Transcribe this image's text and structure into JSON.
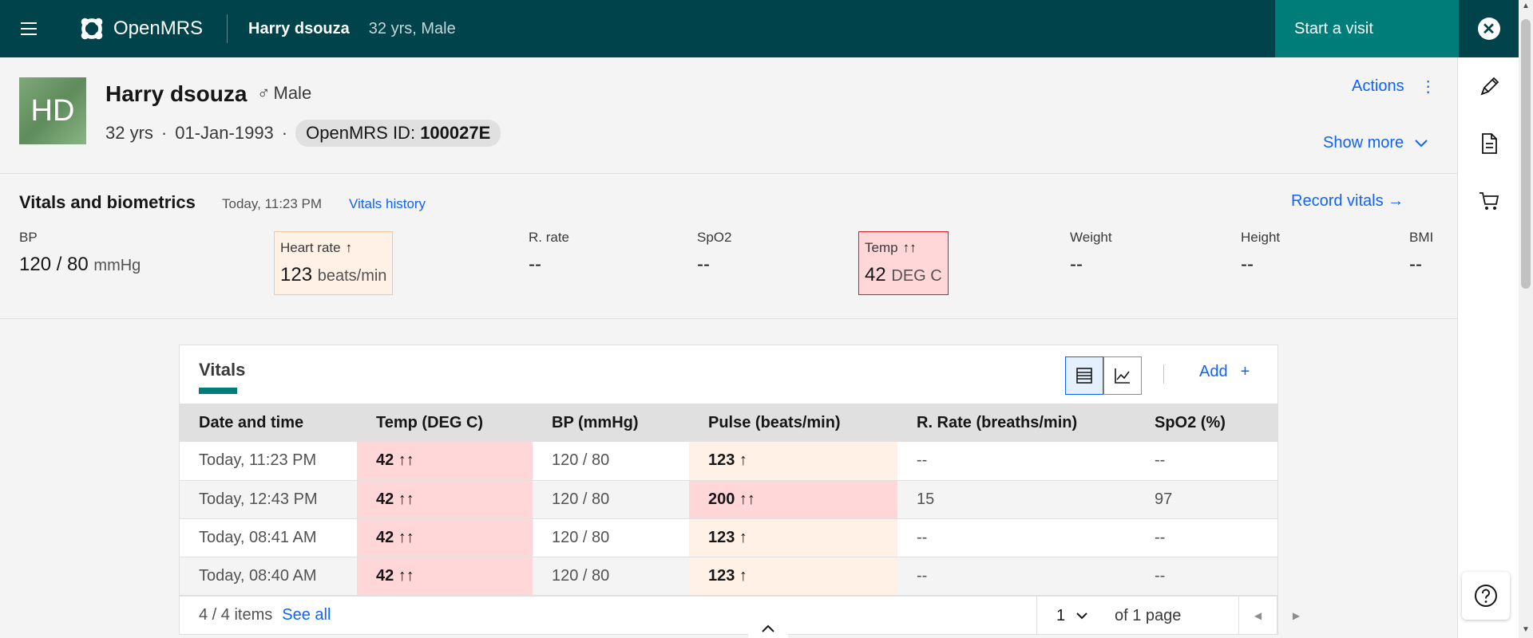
{
  "header": {
    "app_name": "OpenMRS",
    "patient_name": "Harry dsouza",
    "patient_info": "32 yrs, Male",
    "start_visit": "Start a visit"
  },
  "banner": {
    "initials": "HD",
    "name": "Harry dsouza",
    "sex_symbol": "♂",
    "sex": "Male",
    "age": "32 yrs",
    "dot": "·",
    "dob": "01-Jan-1993",
    "id_label": "OpenMRS ID:",
    "id_value": "100027E",
    "actions": "Actions",
    "show_more": "Show more"
  },
  "vitals_header": {
    "title": "Vitals and biometrics",
    "time": "Today, 11:23 PM",
    "history": "Vitals history",
    "record": "Record vitals",
    "items": [
      {
        "label": "BP",
        "value": "120 / 80",
        "unit": "mmHg",
        "flag": ""
      },
      {
        "label": "Heart rate",
        "value": "123",
        "unit": "beats/min",
        "flag": "↑"
      },
      {
        "label": "R. rate",
        "value": "--",
        "unit": "",
        "flag": ""
      },
      {
        "label": "SpO2",
        "value": "--",
        "unit": "",
        "flag": ""
      },
      {
        "label": "Temp",
        "value": "42",
        "unit": "DEG C",
        "flag": "↑↑"
      },
      {
        "label": "Weight",
        "value": "--",
        "unit": "",
        "flag": ""
      },
      {
        "label": "Height",
        "value": "--",
        "unit": "",
        "flag": ""
      },
      {
        "label": "BMI",
        "value": "--",
        "unit": "",
        "flag": ""
      }
    ]
  },
  "card": {
    "title": "Vitals",
    "add": "Add",
    "add_icon": "+",
    "columns": [
      "Date and time",
      "Temp (DEG C)",
      "BP (mmHg)",
      "Pulse (beats/min)",
      "R. Rate (breaths/min)",
      "SpO2 (%)"
    ],
    "rows": [
      {
        "date": "Today, 11:23 PM",
        "temp": "42 ↑↑",
        "bp": "120 / 80",
        "pulse": "123 ↑",
        "rr": "--",
        "spo2": "--"
      },
      {
        "date": "Today, 12:43 PM",
        "temp": "42 ↑↑",
        "bp": "120 / 80",
        "pulse": "200 ↑↑",
        "rr": "15",
        "spo2": "97"
      },
      {
        "date": "Today, 08:41 AM",
        "temp": "42 ↑↑",
        "bp": "120 / 80",
        "pulse": "123 ↑",
        "rr": "--",
        "spo2": "--"
      },
      {
        "date": "Today, 08:40 AM",
        "temp": "42 ↑↑",
        "bp": "120 / 80",
        "pulse": "123 ↑",
        "rr": "--",
        "spo2": "--"
      }
    ],
    "items_count": "4 / 4 items",
    "see_all": "See all",
    "page": "1",
    "of_pages": "of 1 page"
  },
  "colors": {
    "header_bg": "#00434a",
    "accent": "#007d79",
    "link": "#0f62fe",
    "critical_bg": "#ffd7d9",
    "warning_bg": "#fff1e6"
  }
}
